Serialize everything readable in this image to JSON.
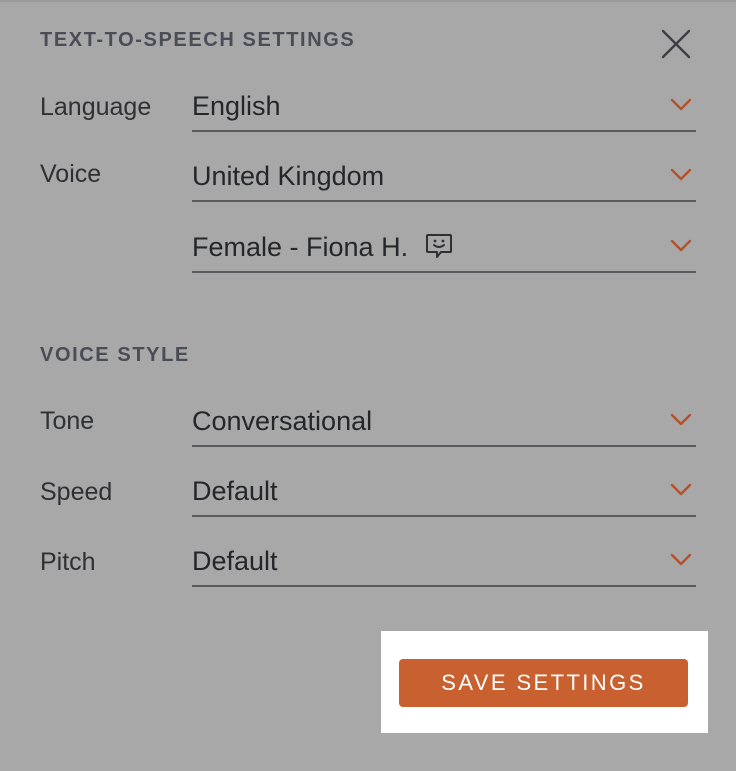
{
  "tts_settings": {
    "title": "TEXT-TO-SPEECH SETTINGS",
    "close_icon": "close-icon",
    "language": {
      "label": "Language",
      "value": "English"
    },
    "voice": {
      "label": "Voice",
      "region_value": "United Kingdom",
      "speaker_value": "Female - Fiona H.",
      "speaker_icon": "smiley-chat-icon"
    }
  },
  "voice_style": {
    "title": "VOICE STYLE",
    "tone": {
      "label": "Tone",
      "value": "Conversational"
    },
    "speed": {
      "label": "Speed",
      "value": "Default"
    },
    "pitch": {
      "label": "Pitch",
      "value": "Default"
    }
  },
  "actions": {
    "save_label": "SAVE SETTINGS"
  },
  "colors": {
    "background": "#a8a8a8",
    "accent": "#c8602f",
    "chevron": "#b5512a",
    "text": "#2f3033",
    "underline": "#5b5b5f"
  }
}
